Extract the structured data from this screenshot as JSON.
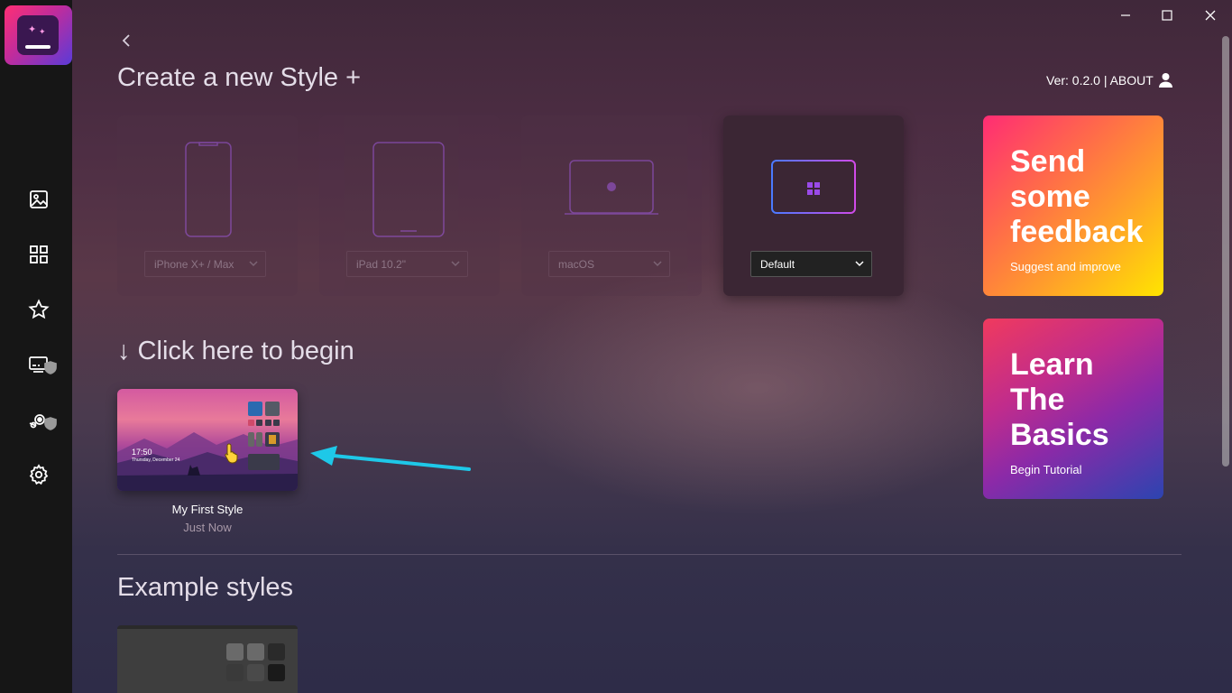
{
  "header": {
    "title": "Create a new Style +",
    "version": "Ver: 0.2.0 | ABOUT"
  },
  "devices": [
    {
      "select_value": "iPhone X+ / Max",
      "icon": "phone-icon"
    },
    {
      "select_value": "iPad 10.2\"",
      "icon": "tablet-icon"
    },
    {
      "select_value": "macOS",
      "icon": "macbook-icon"
    },
    {
      "select_value": "Default",
      "icon": "windows-laptop-icon"
    }
  ],
  "begin": {
    "title": "↓ Click here to begin"
  },
  "my_style": {
    "name": "My First Style",
    "time": "Just Now",
    "thumb_time": "17:50",
    "thumb_date": "Thursday, December 24"
  },
  "examples": {
    "title": "Example styles"
  },
  "feedback": {
    "title": "Send\nsome\nfeedback",
    "subtitle": "Suggest and improve"
  },
  "learn": {
    "title": "Learn\nThe\nBasics",
    "subtitle": "Begin Tutorial"
  },
  "colors": {
    "annotation_arrow": "#1ec8e8",
    "sidebar": "#161616"
  }
}
